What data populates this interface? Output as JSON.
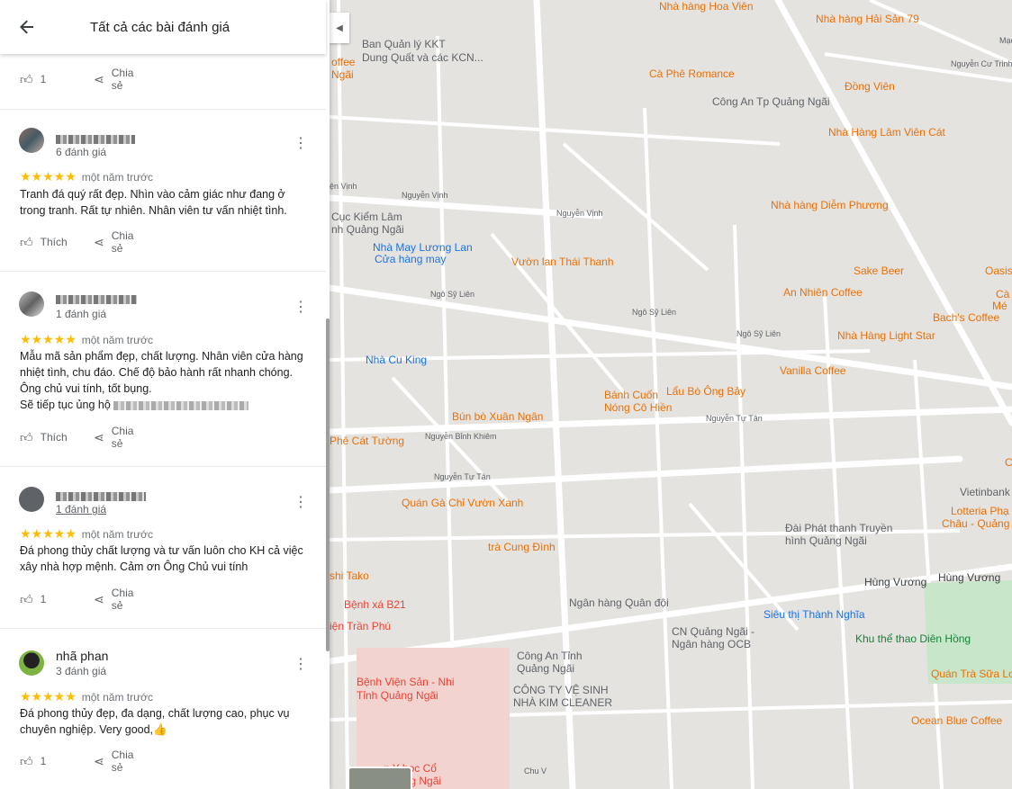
{
  "panel": {
    "title": "Tất cả các bài đánh giá",
    "back_icon": "arrow-left-icon",
    "top_actions": {
      "like_count": "1",
      "share_label": "Chia sẻ"
    },
    "reviews": [
      {
        "name": "",
        "count": "6 đánh giá",
        "stars": "★★★★★",
        "time": "một năm trước",
        "text": "Tranh đá quý rất đẹp. Nhìn vào cảm giác như đang ở trong tranh. Rất tự nhiên. Nhân viên tư vấn nhiệt tình.",
        "like_label": "Thích",
        "share_label": "Chia sẻ"
      },
      {
        "name": "",
        "count": "1 đánh giá",
        "stars": "★★★★★",
        "time": "một năm trước",
        "text": "Mẫu mã sản phẩm đẹp, chất lượng. Nhân viên cửa hàng nhiệt tình, chu đáo. Chế độ bảo hành rất nhanh chóng. Ông chủ vui tính, tốt bụng.",
        "text2": "Sẽ tiếp tục ủng hộ",
        "like_label": "Thích",
        "share_label": "Chia sẻ"
      },
      {
        "name": "",
        "count": "1 đánh giá",
        "stars": "★★★★★",
        "time": "một năm trước",
        "text": "Đá phong thủy chất lượng và tư vấn luôn cho KH cả việc xây nhà hợp mệnh. Cảm ơn Ông Chủ vui tính",
        "like_label": "1",
        "share_label": "Chia sẻ"
      },
      {
        "name": "nhã phan",
        "count": "3 đánh giá",
        "stars": "★★★★★",
        "time": "một năm trước",
        "text": "Đá phong thủy đẹp, đa dạng, chất lượng cao, phục vụ chuyên nghiệp. Very good,👍",
        "like_label": "1",
        "share_label": "Chia sẻ"
      }
    ]
  },
  "map": {
    "pois": [
      {
        "label": "Nhà hàng Hải Sản 79",
        "color": "#e8710a"
      },
      {
        "label": "Ban Quản lý KKT",
        "color": "#5f6368"
      },
      {
        "label": "Dung Quất và các KCN...",
        "color": "#5f6368"
      },
      {
        "label": "Cà Phê Romance",
        "color": "#e8710a"
      },
      {
        "label": "Đồng Viên",
        "color": "#e8710a"
      },
      {
        "label": "Công An Tp Quảng Ngãi",
        "color": "#5f6368"
      },
      {
        "label": "Nhà Hàng Lâm Viên Cát",
        "color": "#e8710a"
      },
      {
        "label": "Nhà hàng Diễm Phương",
        "color": "#e8710a"
      },
      {
        "label": "Cục Kiểm Lâm",
        "color": "#5f6368"
      },
      {
        "label": "nh Quảng Ngãi",
        "color": "#5f6368"
      },
      {
        "label": "Nhà May Lương Lan",
        "color": "#1a73e8"
      },
      {
        "label": "Cửa hàng may",
        "color": "#1a73e8"
      },
      {
        "label": "Vườn lan Thái Thanh",
        "color": "#e8710a"
      },
      {
        "label": "Sake Beer",
        "color": "#e8710a"
      },
      {
        "label": "Oasis",
        "color": "#e8710a"
      },
      {
        "label": "An Nhiên Coffee",
        "color": "#e8710a"
      },
      {
        "label": "Bach's Coffee",
        "color": "#e8710a"
      },
      {
        "label": "Nhà Hàng Light Star",
        "color": "#e8710a"
      },
      {
        "label": "Nhà Cu King",
        "color": "#1a73e8"
      },
      {
        "label": "Vanilla Coffee",
        "color": "#e8710a"
      },
      {
        "label": "Bánh Cuốn",
        "color": "#e8710a"
      },
      {
        "label": "Nóng Cô Hiền",
        "color": "#e8710a"
      },
      {
        "label": "Lẩu Bò Ông Bảy",
        "color": "#e8710a"
      },
      {
        "label": "Bún bò Xuân Ngân",
        "color": "#e8710a"
      },
      {
        "label": "Phê Cát Tường",
        "color": "#e8710a"
      },
      {
        "label": "Quán Gà Chỉ Vườn Xanh",
        "color": "#e8710a"
      },
      {
        "label": "Vietinbank",
        "color": "#5f6368"
      },
      {
        "label": "Đài Phát thanh Truyền",
        "color": "#5f6368"
      },
      {
        "label": "hình Quảng Ngãi",
        "color": "#5f6368"
      },
      {
        "label": "Lotteria Phạ",
        "color": "#e8710a"
      },
      {
        "label": "Châu - Quảng",
        "color": "#e8710a"
      },
      {
        "label": "trà Cung Đình",
        "color": "#e8710a"
      },
      {
        "label": "shi Tako",
        "color": "#e8710a"
      },
      {
        "label": "Bệnh xá B21",
        "color": "#ea4335"
      },
      {
        "label": "Ngân hàng Quân đội",
        "color": "#5f6368"
      },
      {
        "label": "Siêu thị Thành Nghĩa",
        "color": "#1a73e8"
      },
      {
        "label": "CN Quảng Ngãi -",
        "color": "#5f6368"
      },
      {
        "label": "Ngân hàng OCB",
        "color": "#5f6368"
      },
      {
        "label": "Khu thể thao Diên Hồng",
        "color": "#188038"
      },
      {
        "label": "iện Trần Phú",
        "color": "#ea4335"
      },
      {
        "label": "Công An Tỉnh",
        "color": "#5f6368"
      },
      {
        "label": "Quảng Ngãi",
        "color": "#5f6368"
      },
      {
        "label": "Bệnh Viện Sản - Nhi",
        "color": "#ea4335"
      },
      {
        "label": "Tỉnh Quảng Ngãi",
        "color": "#ea4335"
      },
      {
        "label": "CÔNG TY VỆ SINH",
        "color": "#5f6368"
      },
      {
        "label": "NHÀ KIM CLEANER",
        "color": "#5f6368"
      },
      {
        "label": "Quán Trà Sữa Lo",
        "color": "#e8710a"
      },
      {
        "label": "Ocean Blue Coffee",
        "color": "#e8710a"
      },
      {
        "label": "n Y học Cổ",
        "color": "#ea4335"
      },
      {
        "label": "Quảng Ngãi",
        "color": "#ea4335"
      },
      {
        "label": "offee",
        "color": "#e8710a"
      },
      {
        "label": "Ngãi",
        "color": "#e8710a"
      },
      {
        "label": "Cà",
        "color": "#e8710a"
      },
      {
        "label": "Mé",
        "color": "#e8710a"
      },
      {
        "label": "Cà",
        "color": "#e8710a"
      }
    ],
    "roads": [
      "Nguyễn Vịnh",
      "Nguyễn Vịnh",
      "Ngô Sỹ Liên",
      "Ngô Sỹ Liên",
      "Ngô Sỹ Liên",
      "Nguyễn Tự Tân",
      "Nguyễn Bỉnh Khiêm",
      "Nguyễn Tự Tân",
      "Hùng Vương",
      "Hùng Vương",
      "Nguyễn Cư Trinh",
      "Mạc Đĩnh Chi",
      "Chu V",
      "ện Vịnh",
      "Nhà hàng Hoa Viên"
    ]
  }
}
